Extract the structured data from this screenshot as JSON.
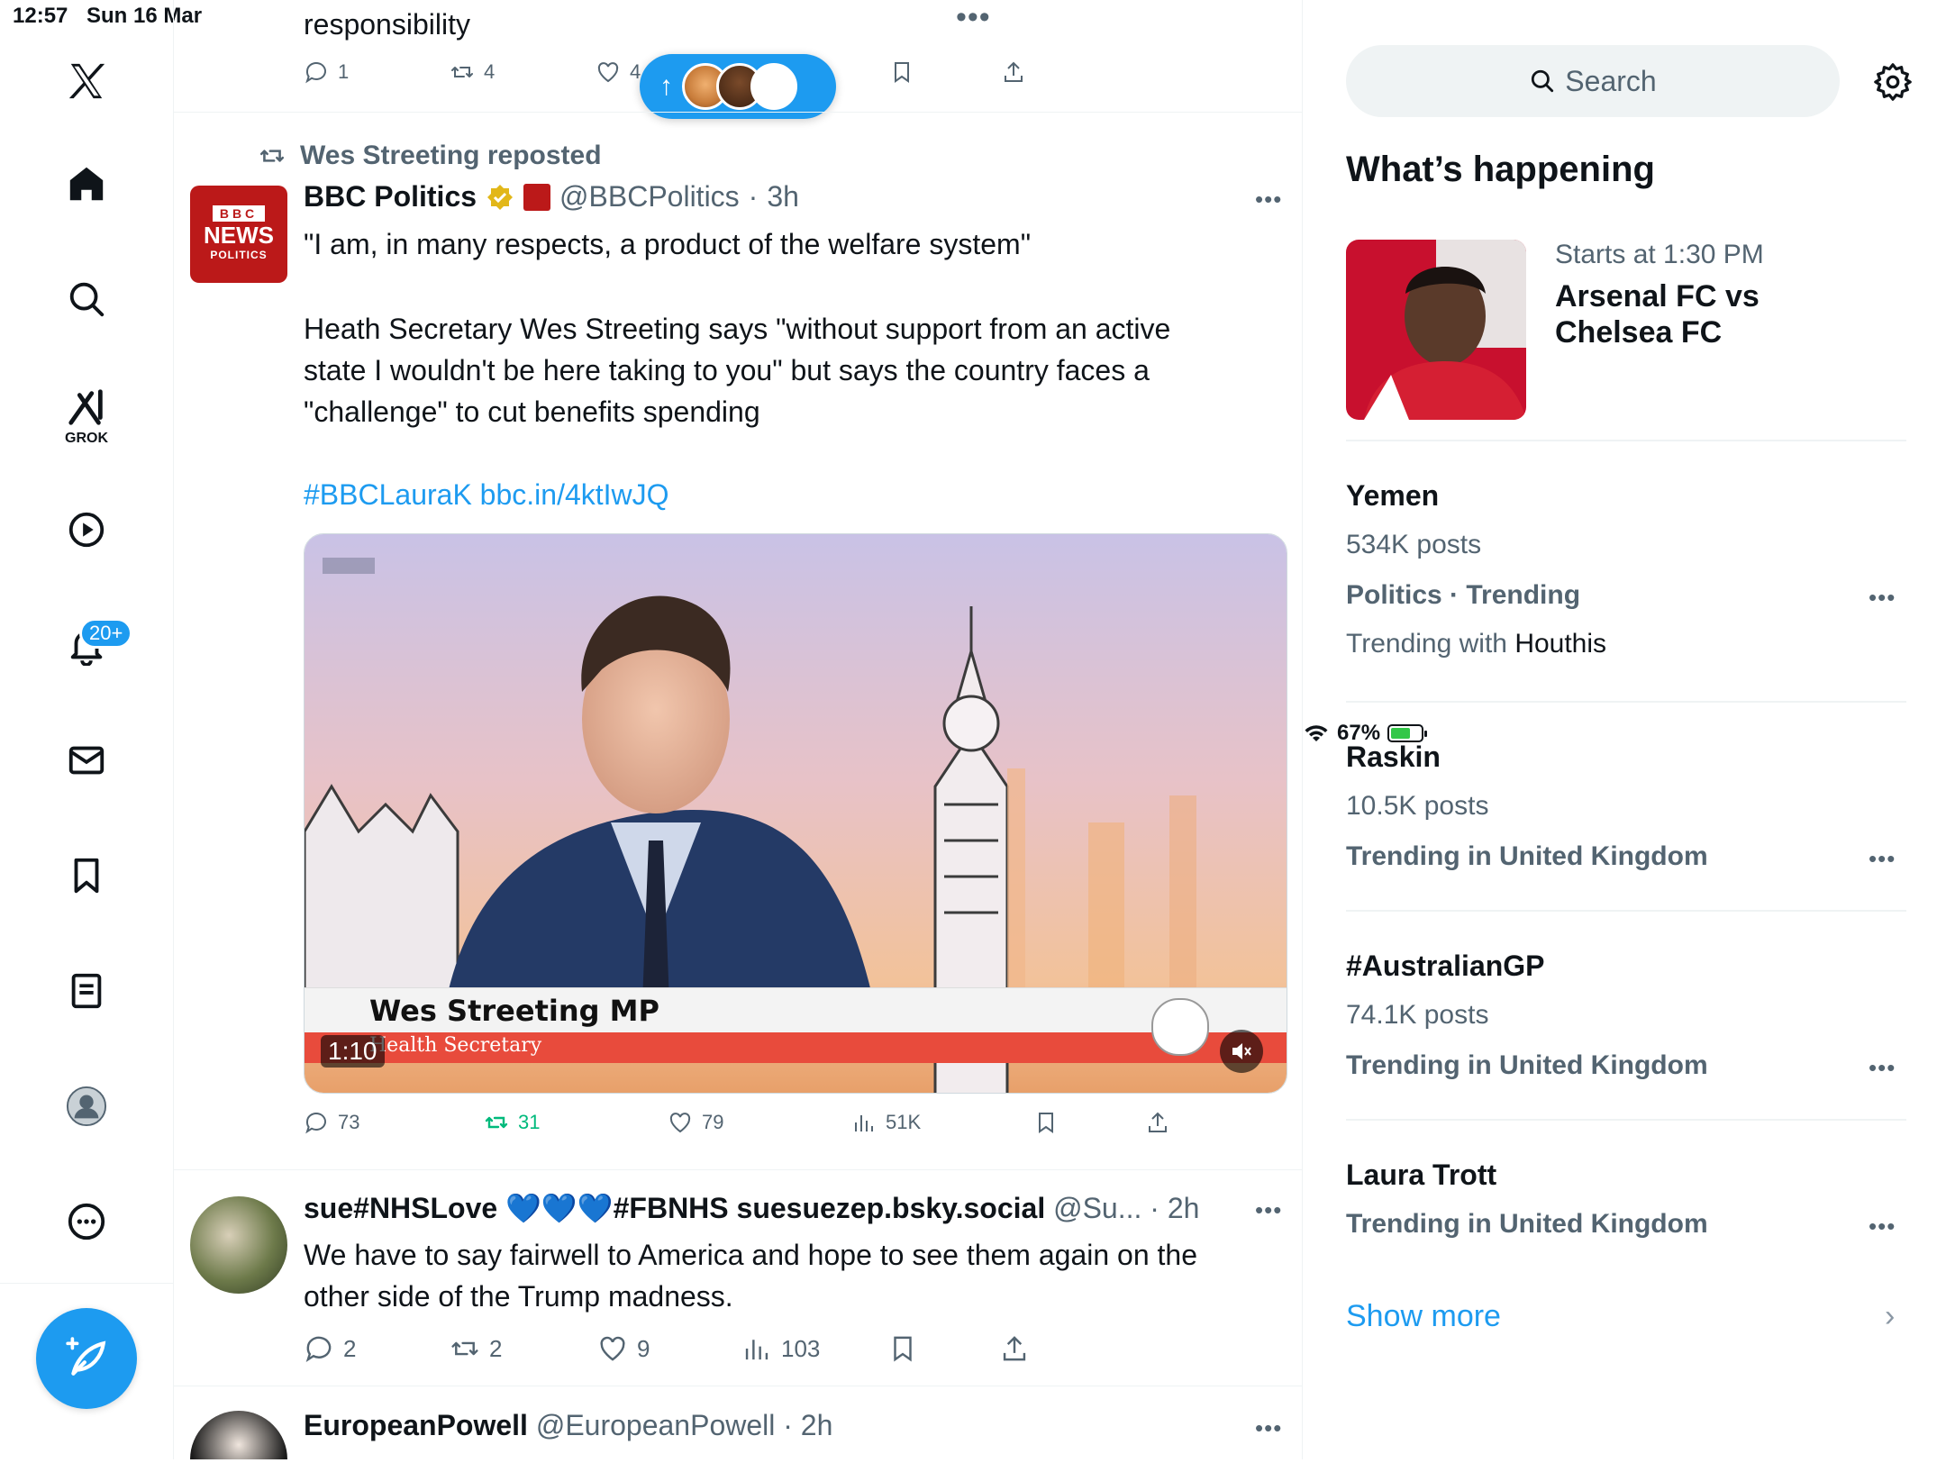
{
  "status_bar": {
    "time": "12:57",
    "date": "Sun 16 Mar",
    "battery": "67%",
    "battery_level": 0.67
  },
  "sidebar": {
    "grok_label": "GROK",
    "notifications_badge": "20+",
    "items": [
      "x-logo",
      "home",
      "search",
      "grok",
      "videos",
      "notifications",
      "messages",
      "bookmarks",
      "lists",
      "profile",
      "more"
    ]
  },
  "feed": {
    "prev_tweet": {
      "text_tail": "responsibility",
      "replies": "1",
      "reposts": "4",
      "likes": "4"
    },
    "tweet1": {
      "repost_label": "Wes Streeting reposted",
      "avatar_line1": "BBC",
      "avatar_line2": "NEWS",
      "avatar_line3": "POLITICS",
      "name": "BBC Politics",
      "handle": "@BBCPolitics",
      "time": "3h",
      "line1": "\"I am, in many respects, a product of the welfare system\"",
      "para2_l1": "Heath Secretary Wes Streeting says \"without support from an active",
      "para2_l2": "state I wouldn't be here taking to you\" but says the country faces a",
      "para2_l3": "\"challenge\" to cut benefits spending",
      "hashtag": "#BBCLauraK",
      "link": "bbc.in/4ktIwJQ",
      "video": {
        "lower_third_name": "Wes Streeting MP",
        "lower_third_role": "Health Secretary",
        "duration": "1:10",
        "corner_logo": "BBC"
      },
      "replies": "73",
      "reposts": "31",
      "likes": "79",
      "views": "51K",
      "repost_color": "#00ba7c"
    },
    "tweet2": {
      "name": "sue#NHSLove 💙💙💙#FBNHS suesuezep.bsky.social",
      "handle": "@Su...",
      "time": "2h",
      "line1": "We have to say fairwell to America and hope to see them again on the",
      "line2": "other side of the Trump madness.",
      "replies": "2",
      "reposts": "2",
      "likes": "9",
      "views": "103"
    },
    "tweet3": {
      "name": "EuropeanPowell",
      "handle": "@EuropeanPowell",
      "time": "2h"
    }
  },
  "right": {
    "search_placeholder": "Search",
    "section_title": "What’s happening",
    "event": {
      "time": "Starts at 1:30 PM",
      "title_l1": "Arsenal FC vs",
      "title_l2": "Chelsea FC"
    },
    "trends": [
      {
        "title": "Yemen",
        "posts": "534K posts",
        "context": "Politics · Trending",
        "with_prefix": "Trending with ",
        "with_name": "Houthis"
      },
      {
        "title": "Raskin",
        "posts": "10.5K posts",
        "context": "Trending in United Kingdom"
      },
      {
        "title": "#AustralianGP",
        "posts": "74.1K posts",
        "context": "Trending in United Kingdom"
      },
      {
        "title": "Laura Trott",
        "context": "Trending in United Kingdom"
      }
    ],
    "show_more": "Show more"
  },
  "colors": {
    "accent": "#1d9bf0",
    "text": "#0f1419",
    "muted": "#536471",
    "bbc_red": "#bb1919"
  }
}
